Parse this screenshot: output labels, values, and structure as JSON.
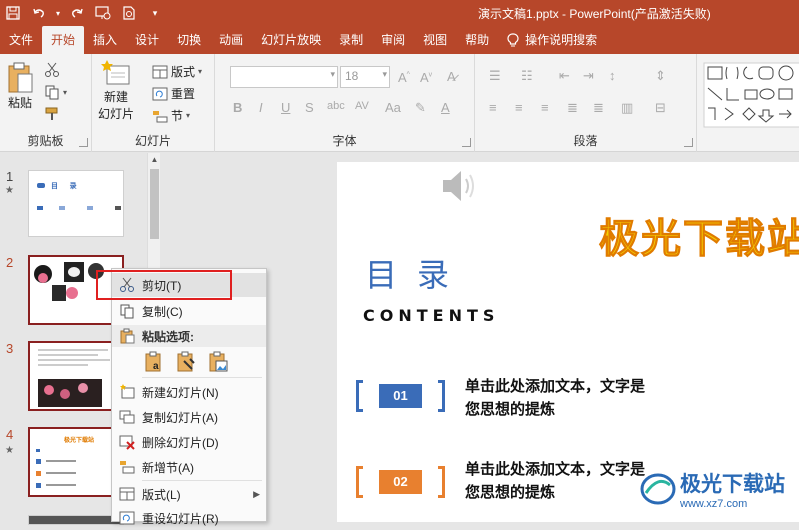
{
  "window": {
    "title": "演示文稿1.pptx  -  PowerPoint(产品激活失败)"
  },
  "quick_access": {
    "save_icon": "save-icon",
    "undo_icon": "undo-icon",
    "redo_icon": "redo-icon",
    "present_icon": "present-from-beginning-icon",
    "preview_icon": "print-preview-icon",
    "customize_icon": "customize-icon"
  },
  "tabs": [
    "文件",
    "开始",
    "插入",
    "设计",
    "切换",
    "动画",
    "幻灯片放映",
    "录制",
    "审阅",
    "视图",
    "帮助"
  ],
  "active_tab": "开始",
  "tell_me": "操作说明搜索",
  "ribbon": {
    "clipboard": {
      "paste": "粘贴",
      "label": "剪贴板"
    },
    "slides": {
      "new_slide_line1": "新建",
      "new_slide_line2": "幻灯片",
      "layout": "版式",
      "reset": "重置",
      "section": "节",
      "label": "幻灯片"
    },
    "font": {
      "font_size": "18",
      "label": "字体"
    },
    "paragraph": {
      "label": "段落"
    }
  },
  "slides_panel": {
    "numbers": [
      "1",
      "2",
      "3",
      "4"
    ],
    "thumb1": {
      "title": "目      录"
    },
    "thumb4": {
      "title": "极光下载站"
    }
  },
  "slide": {
    "title": "目录",
    "subtitle": "CONTENTS",
    "brand": "极光下载站",
    "items": [
      {
        "num": "01",
        "line1": "单击此处添加文本，文字是",
        "line2": "您思想的提炼",
        "color": "#3a6cb8"
      },
      {
        "num": "02",
        "line1": "单击此处添加文本，文字是",
        "line2": "您思想的提炼",
        "color": "#e8802f"
      }
    ]
  },
  "context_menu": {
    "cut": "剪切(T)",
    "copy": "复制(C)",
    "paste_options": "粘贴选项:",
    "new_slide": "新建幻灯片(N)",
    "duplicate_slide": "复制幻灯片(A)",
    "delete_slide": "删除幻灯片(D)",
    "add_section": "新增节(A)",
    "layout": "版式(L)",
    "reset_slide": "重设幻灯片(R)"
  },
  "watermark": {
    "text": "极光下载站",
    "url": "www.xz7.com"
  }
}
